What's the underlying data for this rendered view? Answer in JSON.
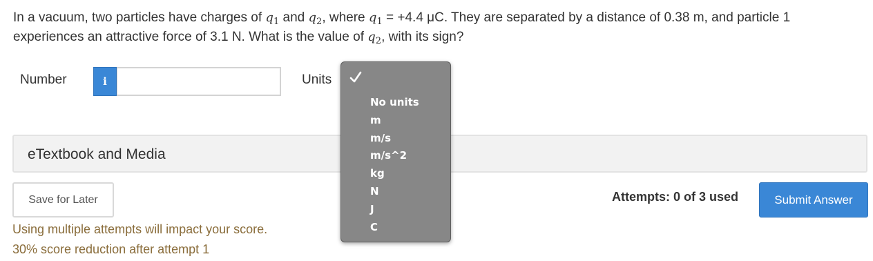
{
  "question": {
    "p1": "In a vacuum, two particles have charges of ",
    "q": "q",
    "sub1": "1",
    "and": " and ",
    "sub2": "2",
    "where": ", where ",
    "eq": " = +4.4 μC. They are separated by a distance of 0.38 m, and particle 1 experiences an attractive force of 3.1 N. What is the value of ",
    "tail": ", with its sign?"
  },
  "answer": {
    "number_label": "Number",
    "info_label": "i",
    "number_value": "",
    "units_label": "Units"
  },
  "units_dropdown": {
    "selected_index": 0,
    "options": [
      "No units",
      "m",
      "m/s",
      "m/s^2",
      "kg",
      "N",
      "J",
      "C"
    ]
  },
  "etextbook": {
    "label": "eTextbook and Media"
  },
  "actions": {
    "save_label": "Save for Later",
    "submit_label": "Submit Answer",
    "attempts": "Attempts: 0 of 3 used"
  },
  "warning": {
    "line1": "Using multiple attempts will impact your score.",
    "line2": "30% score reduction after attempt 1"
  },
  "colors": {
    "accent": "#3a87d6",
    "warning_text": "#8a6d3b",
    "dropdown_bg": "#878787"
  }
}
